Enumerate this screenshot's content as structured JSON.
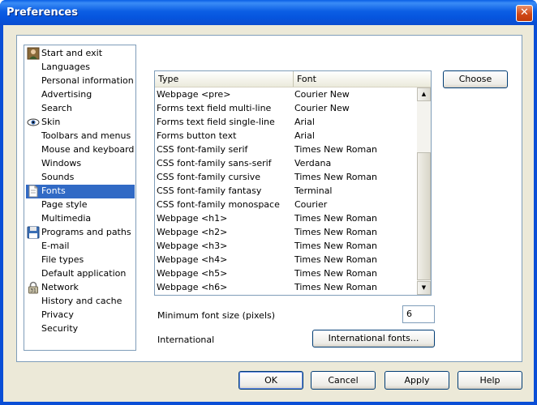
{
  "window": {
    "title": "Preferences"
  },
  "sidebar": {
    "items": [
      {
        "label": "Start and exit",
        "icon": "portrait-icon"
      },
      {
        "label": "Languages",
        "icon": ""
      },
      {
        "label": "Personal information",
        "icon": ""
      },
      {
        "label": "Advertising",
        "icon": ""
      },
      {
        "label": "Search",
        "icon": ""
      },
      {
        "label": "Skin",
        "icon": "eye-icon"
      },
      {
        "label": "Toolbars and menus",
        "icon": ""
      },
      {
        "label": "Mouse and keyboard",
        "icon": ""
      },
      {
        "label": "Windows",
        "icon": ""
      },
      {
        "label": "Sounds",
        "icon": ""
      },
      {
        "label": "Fonts",
        "icon": "document-icon"
      },
      {
        "label": "Page style",
        "icon": ""
      },
      {
        "label": "Multimedia",
        "icon": ""
      },
      {
        "label": "Programs and paths",
        "icon": "floppy-disk-icon"
      },
      {
        "label": "E-mail",
        "icon": ""
      },
      {
        "label": "File types",
        "icon": ""
      },
      {
        "label": "Default application",
        "icon": ""
      },
      {
        "label": "Network",
        "icon": "padlock-icon"
      },
      {
        "label": "History and cache",
        "icon": ""
      },
      {
        "label": "Privacy",
        "icon": ""
      },
      {
        "label": "Security",
        "icon": ""
      }
    ],
    "selected": "Fonts",
    "selected_color": "#316ac5"
  },
  "fonts_list": {
    "columns": {
      "type": "Type",
      "font": "Font"
    },
    "rows": [
      {
        "type": "Webpage <pre>",
        "font": "Courier New"
      },
      {
        "type": "Forms text field multi-line",
        "font": "Courier New"
      },
      {
        "type": "Forms text field single-line",
        "font": "Arial"
      },
      {
        "type": "Forms button text",
        "font": "Arial"
      },
      {
        "type": "CSS font-family serif",
        "font": "Times New Roman"
      },
      {
        "type": "CSS font-family sans-serif",
        "font": "Verdana"
      },
      {
        "type": "CSS font-family cursive",
        "font": "Times New Roman"
      },
      {
        "type": "CSS font-family fantasy",
        "font": "Terminal"
      },
      {
        "type": "CSS font-family monospace",
        "font": "Courier"
      },
      {
        "type": "Webpage <h1>",
        "font": "Times New Roman"
      },
      {
        "type": "Webpage <h2>",
        "font": "Times New Roman"
      },
      {
        "type": "Webpage <h3>",
        "font": "Times New Roman"
      },
      {
        "type": "Webpage <h4>",
        "font": "Times New Roman"
      },
      {
        "type": "Webpage <h5>",
        "font": "Times New Roman"
      },
      {
        "type": "Webpage <h6>",
        "font": "Times New Roman"
      }
    ]
  },
  "choose_label": "Choose",
  "min_font_size": {
    "label": "Minimum font size (pixels)",
    "value": "6"
  },
  "international": {
    "label": "International",
    "button_label": "International fonts..."
  },
  "buttons": {
    "ok": "OK",
    "cancel": "Cancel",
    "apply": "Apply",
    "help": "Help"
  },
  "colors": {
    "title_bar": "#0054e3",
    "dialog_bg": "#ece9d8"
  }
}
